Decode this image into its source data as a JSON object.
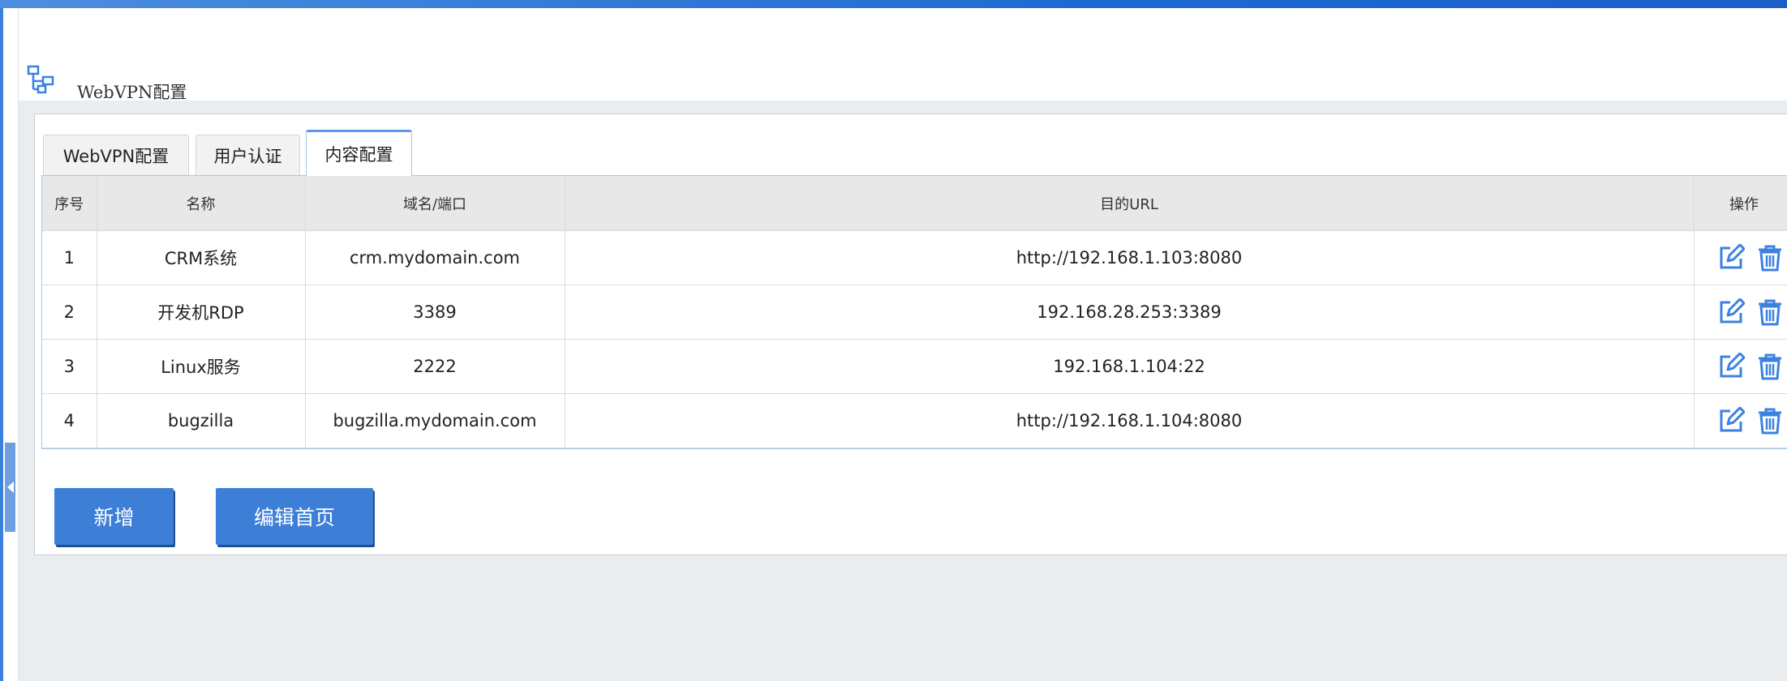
{
  "page": {
    "title": "WebVPN配置",
    "icon": "network-topology-icon"
  },
  "tabs": [
    {
      "label": "WebVPN配置",
      "active": false
    },
    {
      "label": "用户认证",
      "active": false
    },
    {
      "label": "内容配置",
      "active": true
    }
  ],
  "table": {
    "columns": [
      "序号",
      "名称",
      "域名/端口",
      "目的URL",
      "操作"
    ],
    "rows": [
      {
        "index": "1",
        "name": "CRM系统",
        "domain": "crm.mydomain.com",
        "url": "http://192.168.1.103:8080"
      },
      {
        "index": "2",
        "name": "开发机RDP",
        "domain": "3389",
        "url": "192.168.28.253:3389"
      },
      {
        "index": "3",
        "name": "Linux服务",
        "domain": "2222",
        "url": "192.168.1.104:22"
      },
      {
        "index": "4",
        "name": "bugzilla",
        "domain": "bugzilla.mydomain.com",
        "url": "http://192.168.1.104:8080"
      }
    ],
    "row_actions": [
      "edit-icon",
      "delete-icon"
    ]
  },
  "buttons": {
    "add_label": "新增",
    "edit_home_label": "编辑首页"
  },
  "colors": {
    "accent": "#3d7fd6",
    "icon_blue": "#3b82e0",
    "header_bg": "#e8e8e8",
    "content_bg": "#eaedf0"
  }
}
